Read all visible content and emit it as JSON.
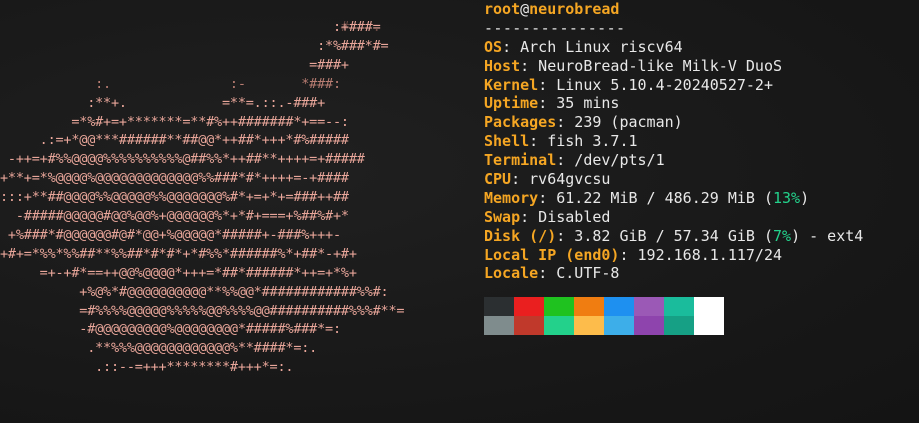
{
  "ascii_art": {
    "lines": [
      "                                          .####.",
      "                                          :+###=",
      "                                        :*%###*#=",
      "                                       =###+",
      "            :.               :-       *###:",
      "           :**+.            =**=.::.-###+",
      "         =*%#+=+*******=**#%++#######*+==--:",
      "     .:=+*@@***######**##@@*++##*+++*#%#####",
      " -++=+#%%@@@@%%%%%%%%%%@##%%*++##**++++=+#####",
      "+**+=*%@@@@%@@@@@@@@@@@@@%%###*#*++++=-+####",
      ":::+**##@@@@%%@@@@@%%@@@@@@@%#*+=+*+=###++##",
      "  -#####@@@@@#@@%@@%+@@@@@@%*+*#+===+%##%#+*",
      " +%###*#@@@@@@#@#*@@+%@@@@@*#####+-###%+++-",
      "+#+=*%%*%%##**%%##*#*#*+*#%%*######%*+##*-+#+",
      "     =+-+#*==++@@%@@@@*+++=*##*######*++=+*%+",
      "          +%@%*#@@@@@@@@@@**%%@@*############%%#:",
      "          =#%%%%@@@@@%%%%%@@%%%%@@##########%%%#**=",
      "          -#@@@@@@@@@%@@@@@@@@*#####%###*=:",
      "           .**%%%@@@@@@@@@@@@%**####*=:.",
      "            .::--=+++********#+++*=:."
    ]
  },
  "info": {
    "user": "root",
    "at": "@",
    "host": "neurobread",
    "separator": "---------------",
    "os_label": "OS",
    "os_value": ": Arch Linux riscv64",
    "host_label": "Host",
    "host_value": ": NeuroBread-like Milk-V DuoS",
    "kernel_label": "Kernel",
    "kernel_value": ": Linux 5.10.4-20240527-2+",
    "uptime_label": "Uptime",
    "uptime_value": ": 35 mins",
    "packages_label": "Packages",
    "packages_value": ": 239 (pacman)",
    "shell_label": "Shell",
    "shell_value": ": fish 3.7.1",
    "terminal_label": "Terminal",
    "terminal_value": ": /dev/pts/1",
    "cpu_label": "CPU",
    "cpu_value": ": rv64gvcsu",
    "memory_label": "Memory",
    "memory_value": ": 61.22 MiB / 486.29 MiB (",
    "memory_pct": "13%",
    "memory_close": ")",
    "swap_label": "Swap",
    "swap_value": ": Disabled",
    "disk_label": "Disk (/)",
    "disk_value": ": 3.82 GiB / 57.34 GiB (",
    "disk_pct": "7%",
    "disk_close": ") - ext4",
    "ip_label": "Local IP (end0)",
    "ip_value": ": 192.168.1.117/24",
    "locale_label": "Locale",
    "locale_value": ": C.UTF-8"
  },
  "colors": {
    "label": "#f5a623",
    "text": "#e8e8e8",
    "percent": "#23d18b",
    "art": "#e9a69a"
  },
  "palette": {
    "row1": [
      "#2b2f31",
      "#ea1f1f",
      "#1fc21f",
      "#f07d11",
      "#1e90f0",
      "#9b59b6",
      "#1abc9c",
      "#ffffff"
    ],
    "row2": [
      "#7f8c8d",
      "#c0392b",
      "#23d18b",
      "#fdbc4b",
      "#3daee9",
      "#8e44ad",
      "#16a085",
      "#ffffff"
    ]
  }
}
